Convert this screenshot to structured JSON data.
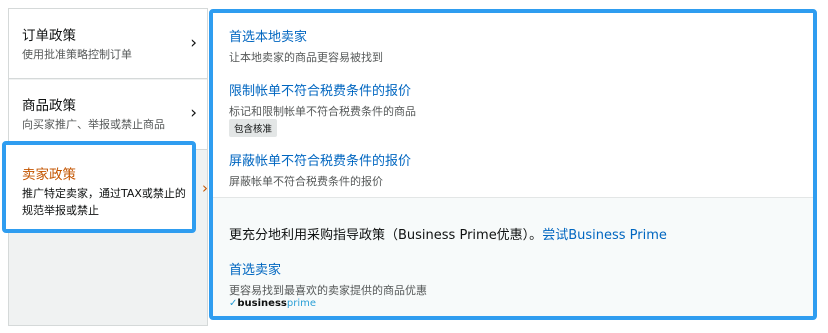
{
  "nav": [
    {
      "title": "订单政策",
      "subtitle": "使用批准策略控制订单",
      "chevron": "›"
    },
    {
      "title": "商品政策",
      "subtitle": "向买家推广、举报或禁止商品",
      "chevron": "›"
    },
    {
      "title": "卖家政策",
      "subtitle": "推广特定卖家，通过TAX或禁止的规范举报或禁止",
      "chevron": "›"
    }
  ],
  "options": [
    {
      "link": "首选本地卖家",
      "desc": "让本地卖家的商品更容易被找到"
    },
    {
      "link": "限制帐单不符合税费条件的报价",
      "desc": "标记和限制帐单不符合税费条件的商品",
      "tag": "包含核准"
    },
    {
      "link": "屏蔽帐单不符合税费条件的报价",
      "desc": "屏蔽帐单不符合税费条件的报价"
    }
  ],
  "business_prime": {
    "headline": "更充分地利用采购指导政策（Business Prime优惠）。",
    "try_link": "尝试Business Prime",
    "option_link": "首选卖家",
    "option_desc": "更容易找到最喜欢的卖家提供的商品优惠",
    "logo_check": "✓",
    "logo_business": "business",
    "logo_prime": "prime"
  },
  "colors": {
    "highlight_frame": "#2f9df0",
    "link": "#0066c0",
    "active_title": "#c45500"
  }
}
